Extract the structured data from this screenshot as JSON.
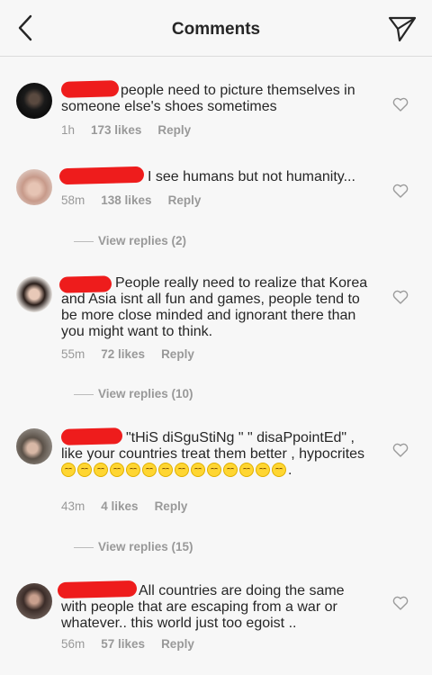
{
  "header": {
    "title": "Comments"
  },
  "comments": [
    {
      "text": "people need to picture themselves in someone else's shoes sometimes",
      "time": "1h",
      "likes": "173 likes",
      "reply": "Reply"
    },
    {
      "text": "I see humans but not humanity...",
      "time": "58m",
      "likes": "138 likes",
      "reply": "Reply",
      "view_replies": "View replies (2)"
    },
    {
      "text": "People really need to realize that Korea and Asia isnt all fun and games, people tend to be more close minded and ignorant there than you might want to think.",
      "time": "55m",
      "likes": "72 likes",
      "reply": "Reply",
      "view_replies": "View replies (10)"
    },
    {
      "text": "\"tHiS diSguStiNg \" \" disaPpointEd\" , like your countries treat them better , hypocrites",
      "trailing": ".",
      "emoji_count": 14,
      "time": "43m",
      "likes": "4 likes",
      "reply": "Reply",
      "view_replies": "View replies (15)"
    },
    {
      "text": "All countries are doing the same with people that are escaping from a war or whatever.. this world just too egoist ..",
      "time": "56m",
      "likes": "57 likes",
      "reply": "Reply"
    }
  ]
}
